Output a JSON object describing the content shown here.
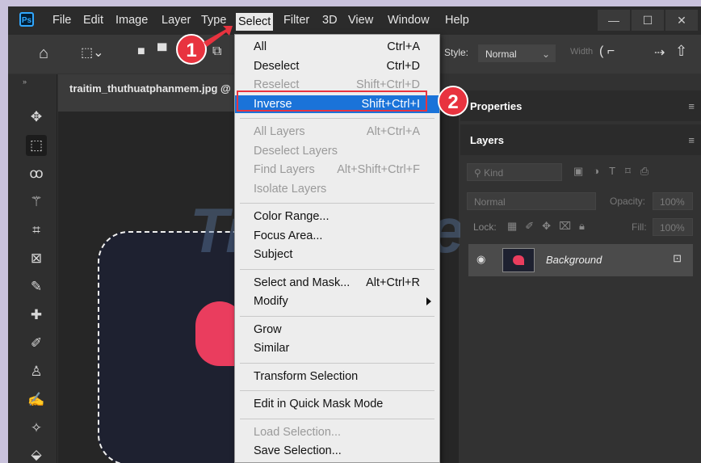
{
  "app": {
    "logo": "Ps"
  },
  "menubar": {
    "items": [
      "File",
      "Edit",
      "Image",
      "Layer",
      "Type",
      "Select",
      "Filter",
      "3D",
      "View",
      "Window",
      "Help"
    ],
    "active": "Select",
    "window_controls": [
      "—",
      "☐",
      "✕"
    ]
  },
  "options_bar": {
    "style_label": "Style:",
    "style_value": "Normal",
    "width_label": "Width"
  },
  "document": {
    "tab_title": "traitim_thuthuatphanmem.jpg @"
  },
  "watermark": "TipsMake",
  "select_menu": {
    "groups": [
      [
        {
          "label": "All",
          "shortcut": "Ctrl+A",
          "disabled": false
        },
        {
          "label": "Deselect",
          "shortcut": "Ctrl+D",
          "disabled": false
        },
        {
          "label": "Reselect",
          "shortcut": "Shift+Ctrl+D",
          "disabled": true
        },
        {
          "label": "Inverse",
          "shortcut": "Shift+Ctrl+I",
          "disabled": false,
          "highlighted": true
        }
      ],
      [
        {
          "label": "All Layers",
          "shortcut": "Alt+Ctrl+A",
          "disabled": true
        },
        {
          "label": "Deselect Layers",
          "shortcut": "",
          "disabled": true
        },
        {
          "label": "Find Layers",
          "shortcut": "Alt+Shift+Ctrl+F",
          "disabled": true
        },
        {
          "label": "Isolate Layers",
          "shortcut": "",
          "disabled": true
        }
      ],
      [
        {
          "label": "Color Range...",
          "shortcut": "",
          "disabled": false
        },
        {
          "label": "Focus Area...",
          "shortcut": "",
          "disabled": false
        },
        {
          "label": "Subject",
          "shortcut": "",
          "disabled": false
        }
      ],
      [
        {
          "label": "Select and Mask...",
          "shortcut": "Alt+Ctrl+R",
          "disabled": false
        },
        {
          "label": "Modify",
          "shortcut": "",
          "disabled": false,
          "submenu": true
        }
      ],
      [
        {
          "label": "Grow",
          "shortcut": "",
          "disabled": false
        },
        {
          "label": "Similar",
          "shortcut": "",
          "disabled": false
        }
      ],
      [
        {
          "label": "Transform Selection",
          "shortcut": "",
          "disabled": false
        }
      ],
      [
        {
          "label": "Edit in Quick Mask Mode",
          "shortcut": "",
          "disabled": false
        }
      ],
      [
        {
          "label": "Load Selection...",
          "shortcut": "",
          "disabled": true
        },
        {
          "label": "Save Selection...",
          "shortcut": "",
          "disabled": false
        }
      ]
    ]
  },
  "annotations": {
    "step1": "1",
    "step2": "2"
  },
  "panels": {
    "properties_tab": "Properties",
    "layers_tab": "Layers",
    "kind_placeholder": "Kind",
    "blend_mode": "Normal",
    "opacity_label": "Opacity:",
    "opacity_value": "100%",
    "lock_label": "Lock:",
    "fill_label": "Fill:",
    "fill_value": "100%",
    "layer_name": "Background"
  },
  "colors": {
    "accent_highlight": "#1a73d9",
    "annotation_red": "#e8333f",
    "heart": "#ea3d5e"
  }
}
